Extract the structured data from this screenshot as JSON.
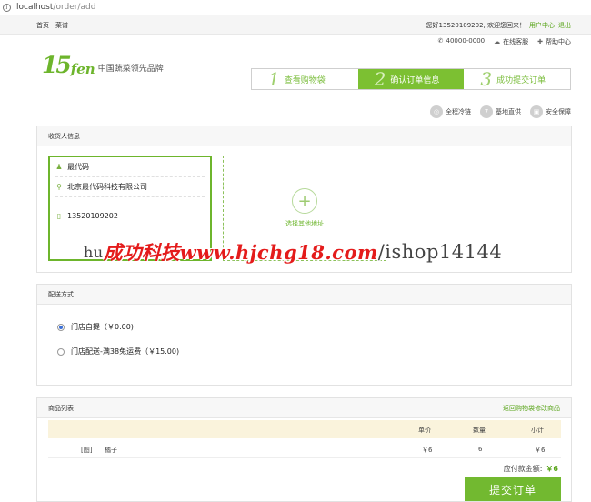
{
  "browser": {
    "host": "localhost",
    "path": "/order/add"
  },
  "topnav": {
    "left": [
      "首页",
      "菜谱"
    ],
    "greeting": "您好13520109202, 欢迎您回来！",
    "user_center": "用户中心",
    "logout": "退出"
  },
  "subnav": {
    "phone": "40000-0000",
    "online": "在线客服",
    "help": "帮助中心"
  },
  "logo": {
    "num": "15",
    "fen": "fen",
    "slogan": "中国蔬菜领先品牌"
  },
  "steps": [
    {
      "n": "1",
      "label": "查看购物袋"
    },
    {
      "n": "2",
      "label": "确认订单信息"
    },
    {
      "n": "3",
      "label": "成功提交订单"
    }
  ],
  "guarantees": [
    {
      "icon": "◎",
      "label": "全程冷链"
    },
    {
      "icon": "7",
      "label": "基地直供"
    },
    {
      "icon": "▣",
      "label": "安全保障"
    }
  ],
  "address": {
    "title": "收货人信息",
    "name": "最代码",
    "addr": "北京最代码科技有限公司",
    "phone": "13520109202",
    "add_label": "选择其他地址"
  },
  "shipping": {
    "title": "配送方式",
    "options": [
      "门店自提（￥0.00)",
      "门店配送-满38免运费（￥15.00)"
    ]
  },
  "goods": {
    "title": "商品列表",
    "back_link": "返回购物袋修改商品",
    "cols": {
      "price": "单价",
      "qty": "数量",
      "subtotal": "小计"
    },
    "items": [
      {
        "img": "[图]",
        "name": "橘子",
        "price": "￥6",
        "qty": "6",
        "subtotal": "￥6"
      }
    ],
    "total_label": "应付款金额:",
    "total": "￥6",
    "submit": "提交订单"
  },
  "watermark": {
    "cn": "成功科技",
    "mid": "www.hjchg18.com",
    "tail": "ishop14144"
  }
}
